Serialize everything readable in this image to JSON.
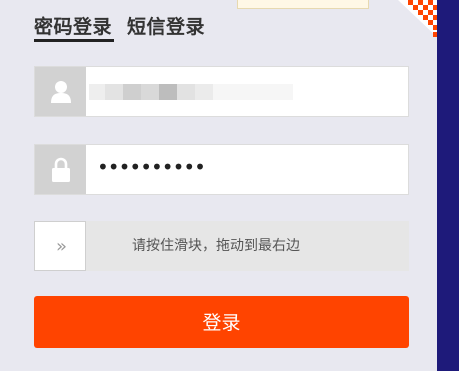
{
  "tabs": {
    "password_login": "密码登录",
    "sms_login": "短信登录"
  },
  "username": {
    "icon": "user-icon",
    "value": ""
  },
  "password": {
    "icon": "lock-icon",
    "masked_value": "••••••••••"
  },
  "slider": {
    "handle_glyph": "»",
    "instruction": "请按住滑块，拖动到最右边"
  },
  "login_button": {
    "label": "登录"
  },
  "colors": {
    "accent": "#ff4400",
    "frame": "#1e1a7a",
    "panel": "#e8e8f0"
  }
}
